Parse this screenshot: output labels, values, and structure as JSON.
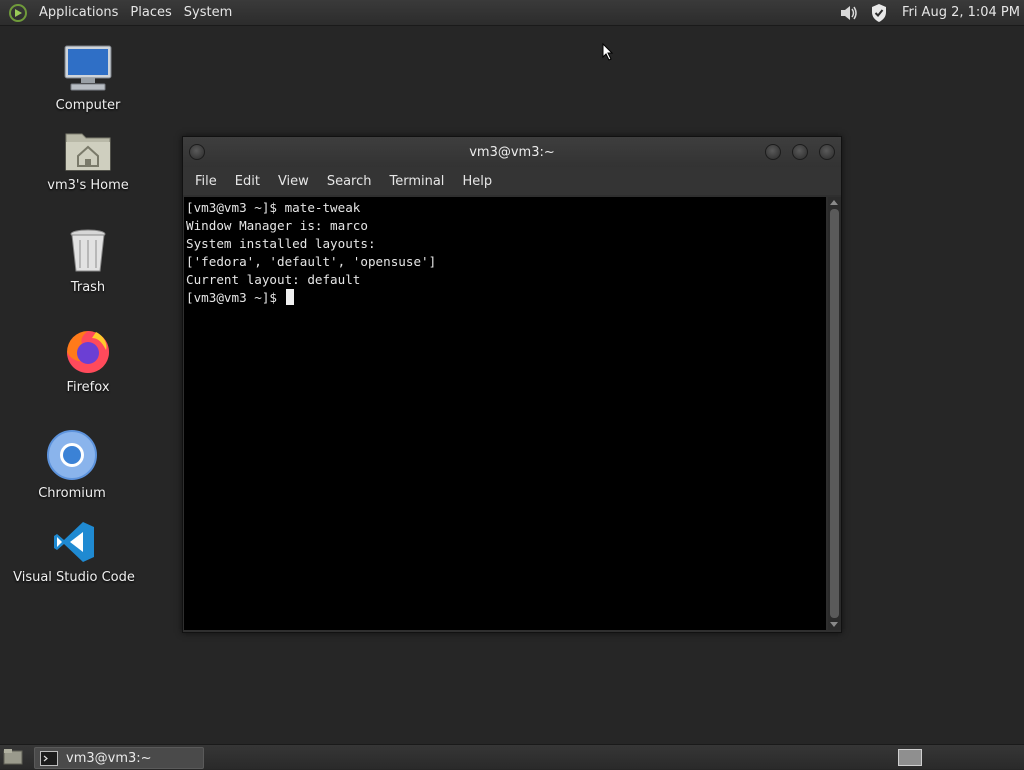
{
  "top_panel": {
    "menus": [
      "Applications",
      "Places",
      "System"
    ],
    "clock": "Fri Aug  2,  1:04 PM"
  },
  "desktop": {
    "icons": [
      {
        "label": "Computer",
        "icon": "computer-icon"
      },
      {
        "label": "vm3's Home",
        "icon": "home-folder-icon"
      },
      {
        "label": "Trash",
        "icon": "trash-icon"
      },
      {
        "label": "Firefox",
        "icon": "firefox-icon"
      },
      {
        "label": "Chromium",
        "icon": "chromium-icon"
      },
      {
        "label": "Visual Studio Code",
        "icon": "vscode-icon"
      }
    ]
  },
  "terminal": {
    "title": "vm3@vm3:~",
    "menu": [
      "File",
      "Edit",
      "View",
      "Search",
      "Terminal",
      "Help"
    ],
    "lines": [
      "[vm3@vm3 ~]$ mate-tweak",
      "Window Manager is: marco",
      "System installed layouts:",
      "['fedora', 'default', 'opensuse']",
      "Current layout: default",
      "[vm3@vm3 ~]$ "
    ]
  },
  "bottom_panel": {
    "task_label": "vm3@vm3:~"
  },
  "colors": {
    "desktop_bg": "#262626",
    "terminal_bg": "#000000",
    "vscode_blue": "#1f8ad2",
    "chromium_blue": "#3b82d6"
  }
}
